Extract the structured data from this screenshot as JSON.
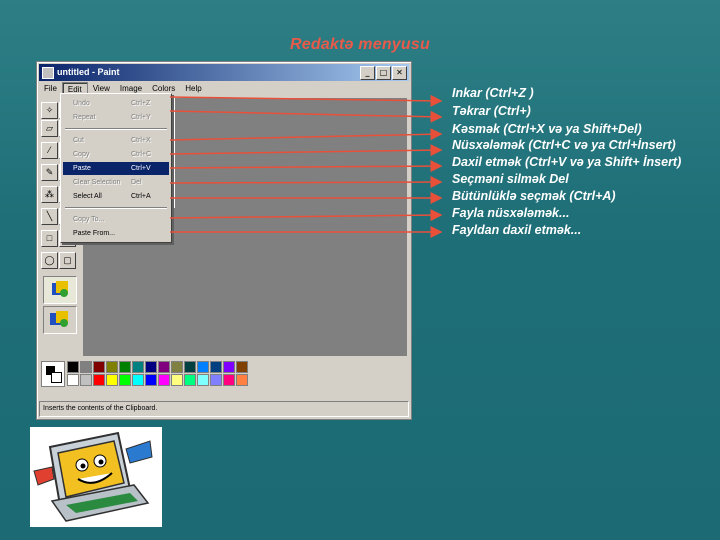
{
  "slide": {
    "title": "Redaktə  menyusu"
  },
  "paint": {
    "title": "untitled - Paint",
    "buttons": {
      "minimize": "_",
      "maximize": "□",
      "close": "✕"
    },
    "menubar": [
      "File",
      "Edit",
      "View",
      "Image",
      "Colors",
      "Help"
    ],
    "active_menu": "Edit",
    "status": "Inserts the contents of the Clipboard.",
    "palette_colors": [
      "#000000",
      "#808080",
      "#800000",
      "#808000",
      "#008000",
      "#008080",
      "#000080",
      "#800080",
      "#808040",
      "#004040",
      "#0080ff",
      "#004080",
      "#8000ff",
      "#804000",
      "#ffffff",
      "#c0c0c0",
      "#ff0000",
      "#ffff00",
      "#00ff00",
      "#00ffff",
      "#0000ff",
      "#ff00ff",
      "#ffff80",
      "#00ff80",
      "#80ffff",
      "#8080ff",
      "#ff0080",
      "#ff8040"
    ],
    "edit_menu": [
      {
        "label": "Undo",
        "shortcut": "Ctrl+Z",
        "state": "disabled"
      },
      {
        "label": "Repeat",
        "shortcut": "Ctrl+Y",
        "state": "disabled"
      },
      {
        "label": "Cut",
        "shortcut": "Ctrl+X",
        "state": "disabled"
      },
      {
        "label": "Copy",
        "shortcut": "Ctrl+C",
        "state": "disabled"
      },
      {
        "label": "Paste",
        "shortcut": "Ctrl+V",
        "state": "highlight"
      },
      {
        "label": "Clear Selection",
        "shortcut": "Del",
        "state": "disabled"
      },
      {
        "label": "Select All",
        "shortcut": "Ctrl+A",
        "state": "normal"
      },
      {
        "label": "Copy To...",
        "shortcut": "",
        "state": "disabled"
      },
      {
        "label": "Paste From...",
        "shortcut": "",
        "state": "normal"
      }
    ]
  },
  "descriptions": [
    " Inkar (Ctrl+Z )",
    "Təkrar (Ctrl+)",
    "Kəsmək (Ctrl+X və ya Shift+Del)",
    "Nüsxələmək (Ctrl+C və ya Ctrl+İnsert)",
    "Daxil etmək (Ctrl+V və ya Shift+ İnsert)",
    "Seçməni silmək   Del",
    "Bütünlüklə seçmək (Ctrl+A)",
    " Fayla nüsxələmək...",
    "Fayldan daxil etmək..."
  ],
  "colors": {
    "arrow": "#e8503a",
    "title": "#e85a4a",
    "highlight": "#0a246a"
  }
}
